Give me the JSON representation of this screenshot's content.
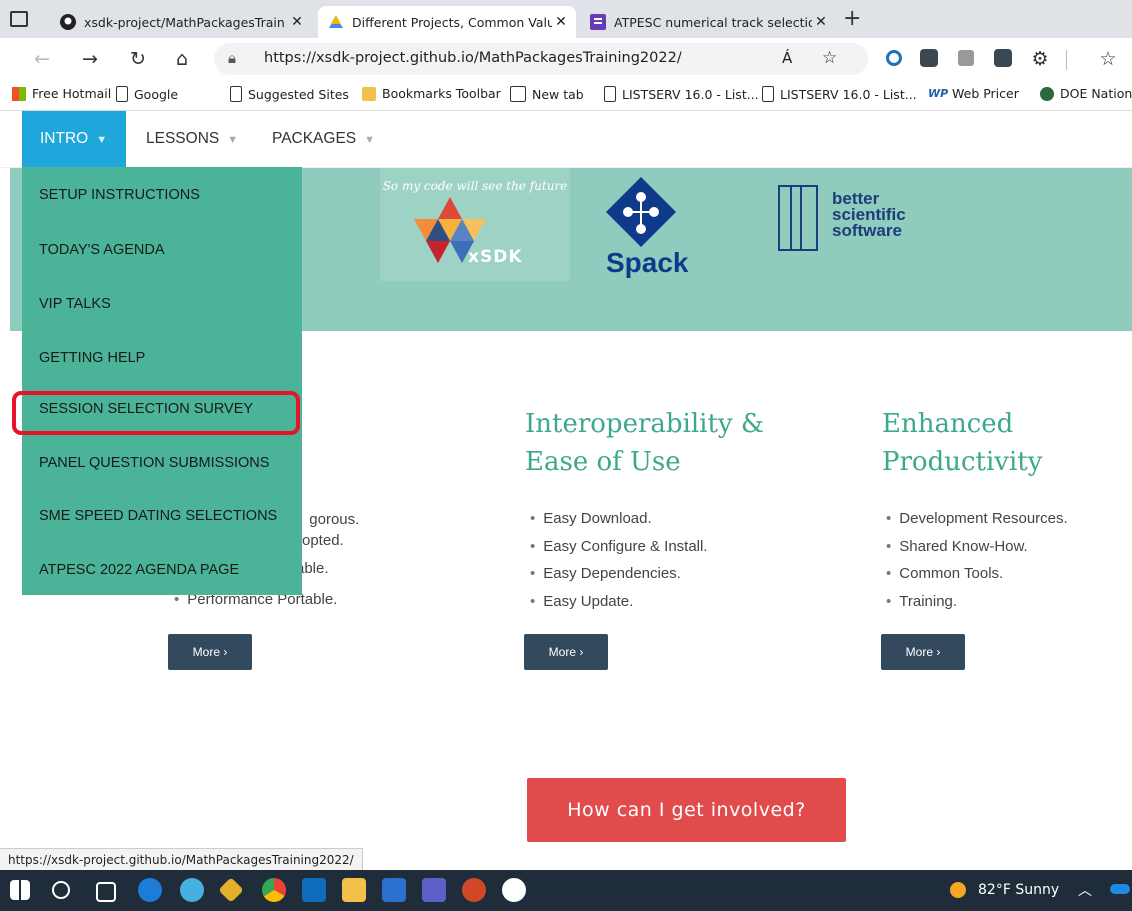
{
  "browser": {
    "tabs": [
      {
        "title": "xsdk-project/MathPackagesTrain",
        "icon": "github-icon"
      },
      {
        "title": "Different Projects, Common Valu",
        "icon": "drive-icon",
        "active": true
      },
      {
        "title": "ATPESC numerical track selection",
        "icon": "forms-icon"
      }
    ],
    "new_tab": "+",
    "url": "https://xsdk-project.github.io/MathPackagesTraining2022/",
    "read_aloud": "Á",
    "favorites": [
      "Free Hotmail",
      "Google",
      "Suggested Sites",
      "Bookmarks Toolbar",
      "New tab",
      "LISTSERV 16.0 - List...",
      "LISTSERV 16.0 - List...",
      "Web Pricer",
      "DOE Nationa"
    ]
  },
  "site": {
    "nav": {
      "intro": "INTRO",
      "lessons": "LESSONS",
      "packages": "PACKAGES"
    },
    "dropdown": [
      "SETUP INSTRUCTIONS",
      "TODAY'S AGENDA",
      "VIP TALKS",
      "GETTING HELP",
      "SESSION SELECTION SURVEY",
      "PANEL QUESTION SUBMISSIONS",
      "SME SPEED DATING SELECTIONS",
      "ATPESC 2022 AGENDA PAGE"
    ],
    "banner": {
      "xsdk_tagline": "So my code will see the future",
      "xsdk_label": "xSDK",
      "spack_label": "Spack",
      "bss_line1": "better",
      "bss_line2": "scientific",
      "bss_line3": "software"
    },
    "col1": {
      "bullets_partial": [
        "gorous.",
        "opted.",
        "able."
      ],
      "last_bullet": "Performance Portable.",
      "more": "More ›"
    },
    "col2": {
      "heading_line1": "Interoperability &",
      "heading_line2": "Ease of Use",
      "bullets": [
        "Easy Download.",
        "Easy Configure & Install.",
        "Easy Dependencies.",
        "Easy Update."
      ],
      "more": "More ›"
    },
    "col3": {
      "heading_line1": "Enhanced",
      "heading_line2": "Productivity",
      "bullets": [
        "Development Resources.",
        "Shared Know-How.",
        "Common Tools.",
        "Training."
      ],
      "more": "More ›"
    },
    "cta": "How can I get involved?"
  },
  "status_url": "https://xsdk-project.github.io/MathPackagesTraining2022/",
  "taskbar": {
    "weather": "82°F  Sunny"
  },
  "colors": {
    "accent_blue": "#1fa7db",
    "menu_green": "#4ab398",
    "heading_green": "#3ea88d",
    "highlight_red": "#e4152b",
    "cta_red": "#e14b4b"
  }
}
